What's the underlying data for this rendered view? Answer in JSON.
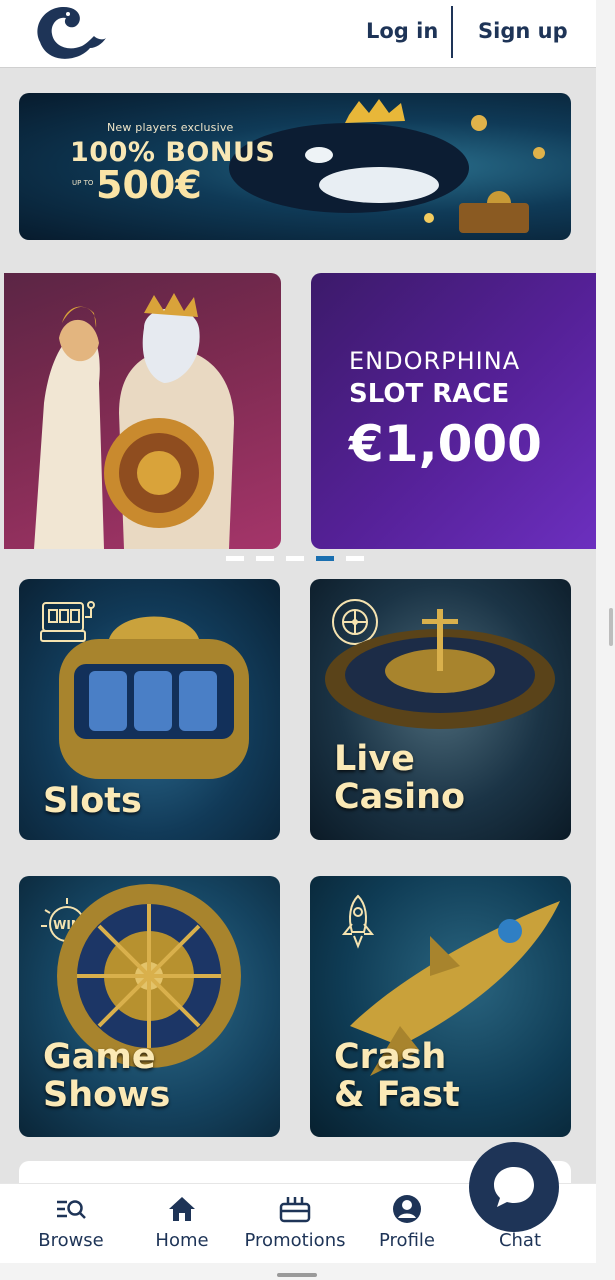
{
  "header": {
    "login_label": "Log in",
    "signup_label": "Sign up",
    "logo_icon": "orca-logo-icon"
  },
  "bonus_banner": {
    "small_text": "New players exclusive",
    "main_text": "100% BONUS",
    "upto_text": "UP TO",
    "amount_text": "500€"
  },
  "carousel": {
    "slides": [
      {
        "name": "zeus-promo"
      },
      {
        "brand": "ENDORPHINA",
        "title": "SLOT RACE",
        "prize": "€1,000"
      }
    ],
    "dot_count": 5,
    "active_dot": 3
  },
  "categories": [
    {
      "label": "Slots",
      "icon": "slot-machine-icon"
    },
    {
      "label": "Live\nCasino",
      "icon": "roulette-wheel-icon"
    },
    {
      "label": "Game\nShows",
      "icon": "win-badge-icon"
    },
    {
      "label": "Crash\n& Fast",
      "icon": "rocket-icon"
    }
  ],
  "bottom_nav": {
    "items": [
      {
        "label": "Browse",
        "icon": "browse-search-icon"
      },
      {
        "label": "Home",
        "icon": "home-icon"
      },
      {
        "label": "Promotions",
        "icon": "gift-icon"
      },
      {
        "label": "Profile",
        "icon": "profile-icon"
      },
      {
        "label": "Chat",
        "icon": "chat-icon"
      }
    ]
  },
  "colors": {
    "brand_navy": "#1e3457",
    "background": "#e3e3e3",
    "gold_text": "#fbe9b6",
    "active_dot": "#1a6fb0",
    "endorphina_purple": "#562199"
  }
}
